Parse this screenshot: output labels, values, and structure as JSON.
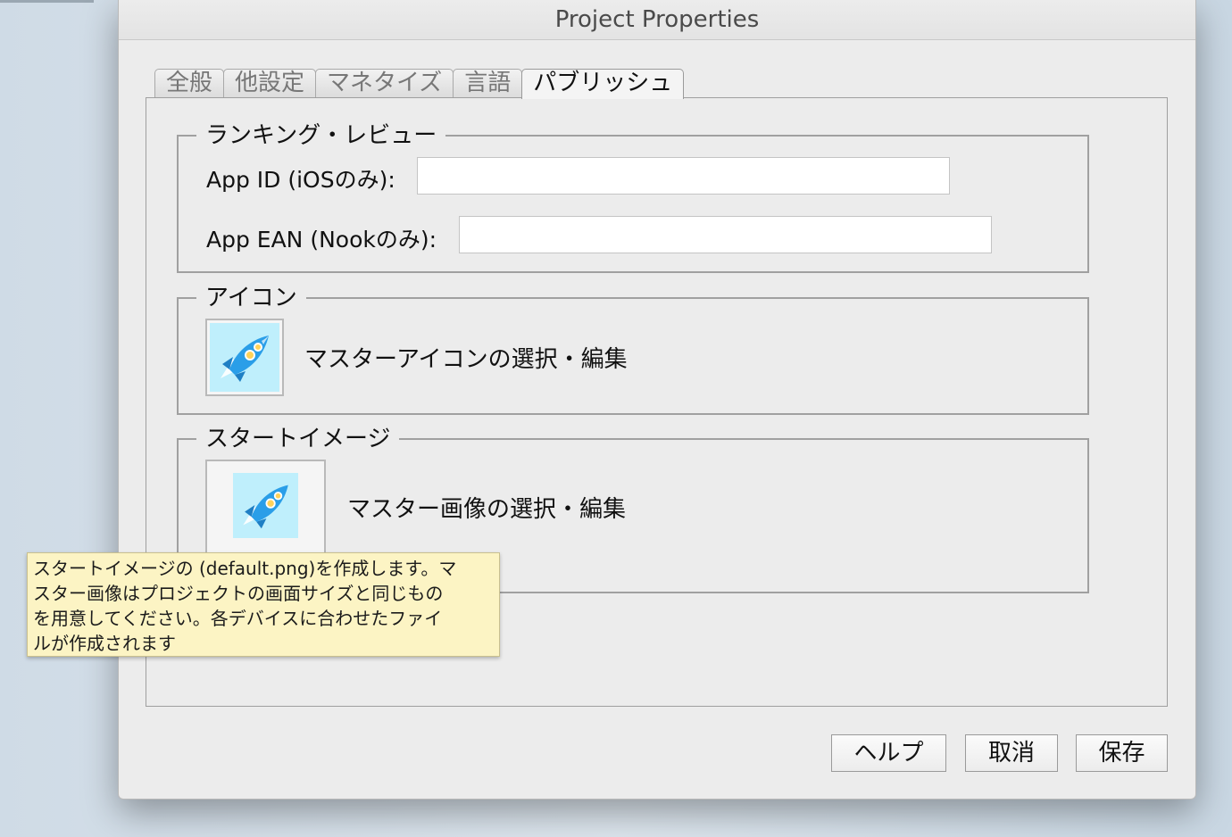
{
  "window": {
    "title": "Project Properties"
  },
  "tabs": [
    {
      "label": "全般"
    },
    {
      "label": "他設定"
    },
    {
      "label": "マネタイズ"
    },
    {
      "label": "言語"
    },
    {
      "label": "パブリッシュ"
    }
  ],
  "active_tab": "パブリッシュ",
  "ranking": {
    "legend": "ランキング・レビュー",
    "app_id_label": "App ID (iOSのみ):",
    "app_id_value": "",
    "app_ean_label": "App EAN (Nookのみ):",
    "app_ean_value": ""
  },
  "icon_group": {
    "legend": "アイコン",
    "select_text": "マスターアイコンの選択・編集",
    "icon": "rocket-icon"
  },
  "start_image": {
    "legend": "スタートイメージ",
    "select_text": "マスター画像の選択・編集",
    "icon": "rocket-icon"
  },
  "tooltip": {
    "lines": [
      "スタートイメージの (default.png)を作成します。マ",
      "スター画像はプロジェクトの画面サイズと同じもの",
      "を用意してください。各デバイスに合わせたファイ",
      "ルが作成されます"
    ]
  },
  "buttons": {
    "help": "ヘルプ",
    "cancel": "取消",
    "save": "保存"
  },
  "colors": {
    "tooltip_bg": "#fcf4c4",
    "rocket_bg": "#bfeffc",
    "rocket_body": "#2a9ee8"
  }
}
